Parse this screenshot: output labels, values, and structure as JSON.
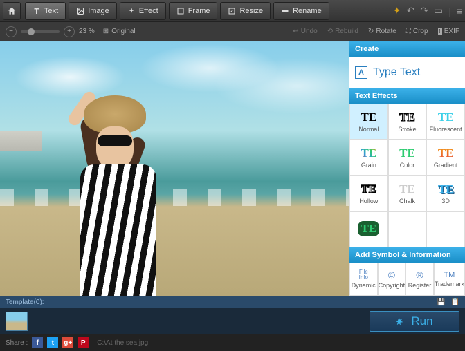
{
  "toolbar": {
    "tabs": [
      "Text",
      "Image",
      "Effect",
      "Frame",
      "Resize",
      "Rename"
    ]
  },
  "secbar": {
    "zoom_pct": "23 %",
    "original": "Original",
    "undo": "Undo",
    "rebuild": "Rebuild",
    "rotate": "Rotate",
    "crop": "Crop",
    "exif": "EXIF"
  },
  "panel": {
    "create": "Create",
    "type_text": "Type Text",
    "text_effects": "Text Effects",
    "effects": [
      "Normal",
      "Stroke",
      "Fluorescent",
      "Grain",
      "Color",
      "Gradient",
      "Hollow",
      "Chalk",
      "3D",
      ""
    ],
    "te_sample": "TE",
    "add_symbol": "Add Symbol & Information",
    "symbols": [
      "Dynamic",
      "Copyright",
      "Register",
      "Trademark"
    ],
    "file_info": "File\nInfo",
    "copyright_sym": "©",
    "register_sym": "®",
    "trademark_sym": "TM"
  },
  "bottom": {
    "template": "Template(0):",
    "run": "Run",
    "share": "Share :",
    "filepath": "C:\\At the sea.jpg"
  }
}
